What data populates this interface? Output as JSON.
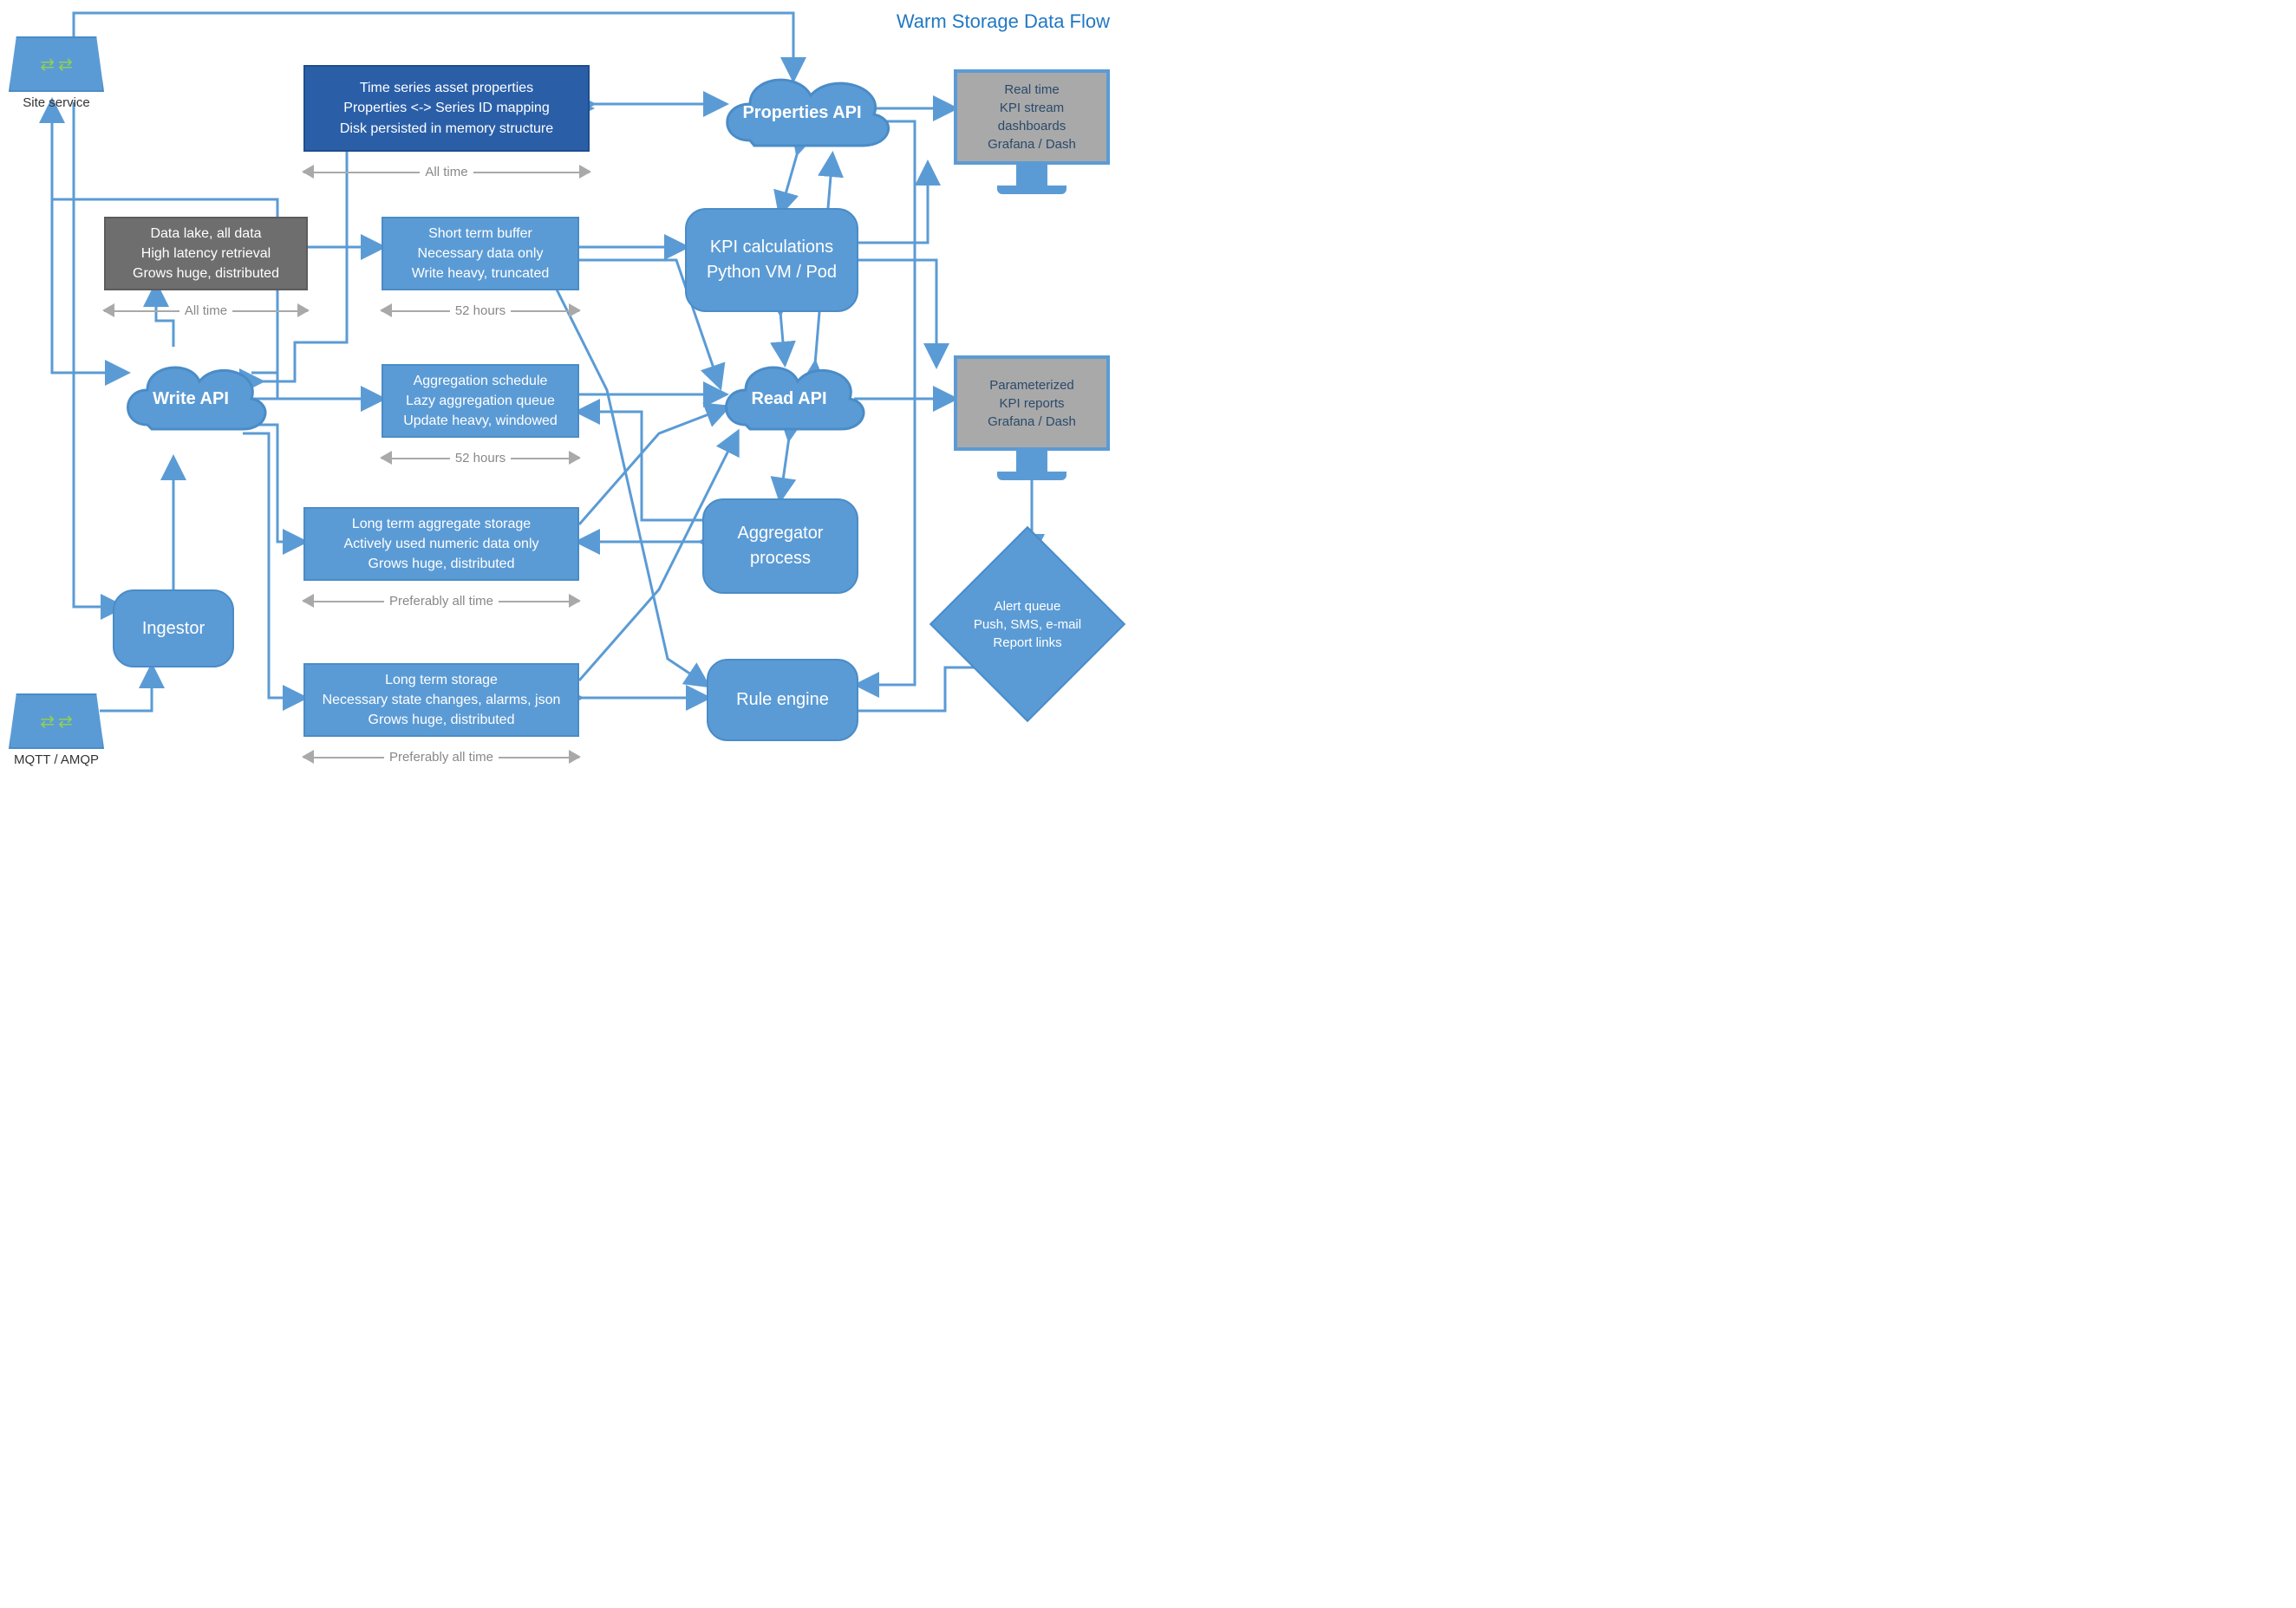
{
  "title": "Warm Storage Data Flow",
  "nodes": {
    "site_service": {
      "label": "Site service"
    },
    "mqtt": {
      "label": "MQTT / AMQP"
    },
    "write_api": {
      "label": "Write API"
    },
    "read_api": {
      "label": "Read API"
    },
    "properties_api": {
      "label": "Properties API"
    },
    "ingestor": {
      "label": "Ingestor"
    },
    "ts_props": {
      "l1": "Time series asset properties",
      "l2": "Properties <-> Series ID mapping",
      "l3": "Disk persisted in memory structure"
    },
    "data_lake": {
      "l1": "Data lake, all data",
      "l2": "High latency retrieval",
      "l3": "Grows huge, distributed"
    },
    "short_buffer": {
      "l1": "Short term buffer",
      "l2": "Necessary data only",
      "l3": "Write heavy, truncated"
    },
    "agg_schedule": {
      "l1": "Aggregation schedule",
      "l2": "Lazy aggregation queue",
      "l3": "Update heavy, windowed"
    },
    "long_agg": {
      "l1": "Long term aggregate storage",
      "l2": "Actively used numeric data only",
      "l3": "Grows huge, distributed"
    },
    "long_store": {
      "l1": "Long term storage",
      "l2": "Necessary state changes, alarms, json",
      "l3": "Grows huge, distributed"
    },
    "kpi_calc": {
      "l1": "KPI calculations",
      "l2": "Python VM / Pod"
    },
    "aggregator": {
      "l1": "Aggregator",
      "l2": "process"
    },
    "rule_engine": {
      "l1": "Rule engine"
    },
    "alert": {
      "l1": "Alert queue",
      "l2": "Push, SMS, e-mail",
      "l3": "Report links"
    },
    "monitor1": {
      "l1": "Real time",
      "l2": "KPI stream",
      "l3": "dashboards",
      "l4": "Grafana / Dash"
    },
    "monitor2": {
      "l1": "Parameterized",
      "l2": "KPI reports",
      "l3": "Grafana / Dash"
    }
  },
  "time_labels": {
    "all_time": "All time",
    "h52": "52 hours",
    "pref": "Preferably all time"
  }
}
